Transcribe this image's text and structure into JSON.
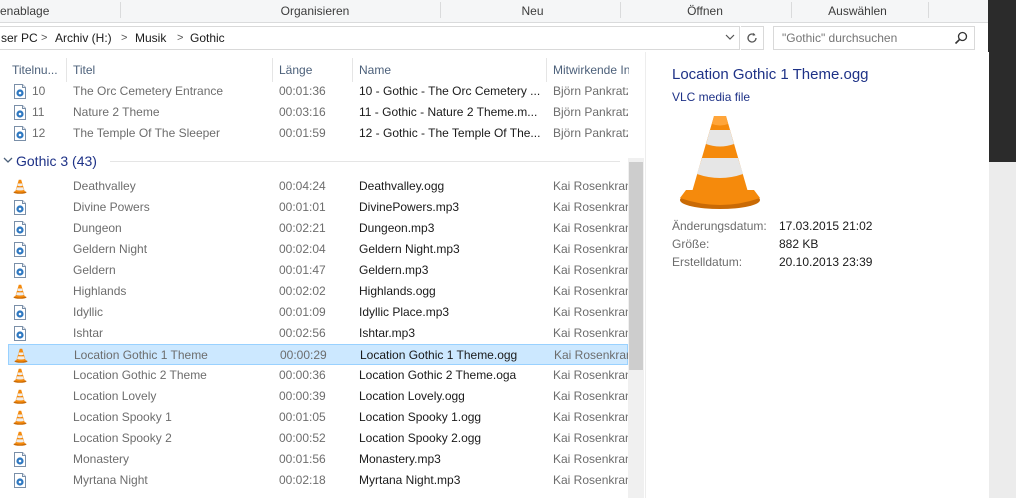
{
  "ribbon": {
    "groups": [
      "enablage",
      "Organisieren",
      "Neu",
      "Öffnen",
      "Auswählen"
    ]
  },
  "address": {
    "crumbs": [
      "ser PC",
      "Archiv (H:)",
      "Musik",
      "Gothic"
    ],
    "separator": ">"
  },
  "search": {
    "placeholder": "\"Gothic\" durchsuchen"
  },
  "columns": [
    "Titelnu...",
    "Titel",
    "Länge",
    "Name",
    "Mitwirkende In"
  ],
  "group": {
    "label": "Gothic 3 (43)"
  },
  "rows_top": [
    {
      "icon": "mp3-file-icon",
      "num": "10",
      "title": "The Orc Cemetery Entrance",
      "length": "00:01:36",
      "name": "10 - Gothic - The Orc Cemetery ...",
      "artist": "Björn Pankratz"
    },
    {
      "icon": "mp3-file-icon",
      "num": "11",
      "title": "Nature 2 Theme",
      "length": "00:03:16",
      "name": "11 - Gothic - Nature 2 Theme.m...",
      "artist": "Björn Pankratz"
    },
    {
      "icon": "mp3-file-icon",
      "num": "12",
      "title": "The Temple Of The Sleeper",
      "length": "00:01:59",
      "name": "12 - Gothic - The Temple Of The...",
      "artist": "Björn Pankratz"
    }
  ],
  "rows": [
    {
      "icon": "vlc-cone-icon",
      "title": "Deathvalley",
      "length": "00:04:24",
      "name": "Deathvalley.ogg",
      "artist": "Kai Rosenkranz"
    },
    {
      "icon": "mp3-file-icon",
      "title": "Divine Powers",
      "length": "00:01:01",
      "name": "DivinePowers.mp3",
      "artist": "Kai Rosenkranz"
    },
    {
      "icon": "mp3-file-icon",
      "title": "Dungeon",
      "length": "00:02:21",
      "name": "Dungeon.mp3",
      "artist": "Kai Rosenkranz"
    },
    {
      "icon": "mp3-file-icon",
      "title": "Geldern Night",
      "length": "00:02:04",
      "name": "Geldern Night.mp3",
      "artist": "Kai Rosenkranz"
    },
    {
      "icon": "mp3-file-icon",
      "title": "Geldern",
      "length": "00:01:47",
      "name": "Geldern.mp3",
      "artist": "Kai Rosenkranz"
    },
    {
      "icon": "vlc-cone-icon",
      "title": "Highlands",
      "length": "00:02:02",
      "name": "Highlands.ogg",
      "artist": "Kai Rosenkranz"
    },
    {
      "icon": "mp3-file-icon",
      "title": "Idyllic",
      "length": "00:01:09",
      "name": "Idyllic Place.mp3",
      "artist": "Kai Rosenkranz"
    },
    {
      "icon": "mp3-file-icon",
      "title": "Ishtar",
      "length": "00:02:56",
      "name": "Ishtar.mp3",
      "artist": "Kai Rosenkranz"
    },
    {
      "icon": "vlc-cone-icon",
      "title": "Location Gothic 1 Theme",
      "length": "00:00:29",
      "name": "Location Gothic 1 Theme.ogg",
      "artist": "Kai Rosenkranz",
      "selected": true
    },
    {
      "icon": "vlc-cone-icon",
      "title": "Location Gothic 2 Theme",
      "length": "00:00:36",
      "name": "Location Gothic 2 Theme.oga",
      "artist": "Kai Rosenkranz"
    },
    {
      "icon": "vlc-cone-icon",
      "title": "Location Lovely",
      "length": "00:00:39",
      "name": "Location Lovely.ogg",
      "artist": "Kai Rosenkranz"
    },
    {
      "icon": "vlc-cone-icon",
      "title": "Location Spooky 1",
      "length": "00:01:05",
      "name": "Location Spooky 1.ogg",
      "artist": "Kai Rosenkranz"
    },
    {
      "icon": "vlc-cone-icon",
      "title": "Location Spooky 2",
      "length": "00:00:52",
      "name": "Location Spooky 2.ogg",
      "artist": "Kai Rosenkranz"
    },
    {
      "icon": "mp3-file-icon",
      "title": "Monastery",
      "length": "00:01:56",
      "name": "Monastery.mp3",
      "artist": "Kai Rosenkranz"
    },
    {
      "icon": "mp3-file-icon",
      "title": "Myrtana Night",
      "length": "00:02:18",
      "name": "Myrtana Night.mp3",
      "artist": "Kai Rosenkranz"
    }
  ],
  "preview": {
    "title": "Location Gothic 1 Theme.ogg",
    "type": "VLC media file",
    "props": [
      {
        "label": "Änderungsdatum:",
        "value": "17.03.2015 21:02"
      },
      {
        "label": "Größe:",
        "value": "882 KB"
      },
      {
        "label": "Erstelldatum:",
        "value": "20.10.2013 23:39"
      }
    ]
  },
  "colors": {
    "accent": "#1e3287",
    "selection": "#cce8ff",
    "selection_border": "#99d1ff",
    "vlc_orange": "#f58a0c"
  }
}
